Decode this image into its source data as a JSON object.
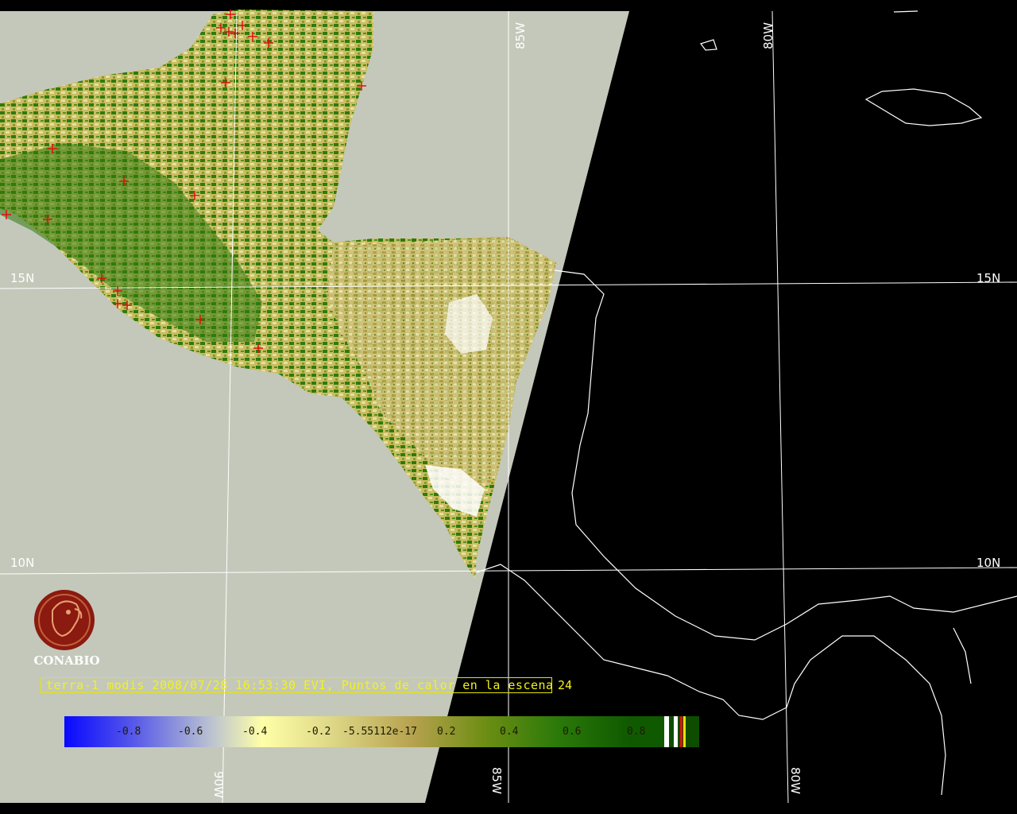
{
  "caption": {
    "text": "terra-1 modis 2008/07/28 16:53:30 EVI, Puntos de calor en la escena",
    "count": "24"
  },
  "logo": {
    "text": "CONABIO",
    "icon": "conabio-macaw-icon",
    "color": "#8b1a10"
  },
  "grid": {
    "lat_labels": [
      "15N",
      "15N",
      "10N",
      "10N"
    ],
    "lon_labels_top": [
      "85W",
      "80W"
    ],
    "lon_labels_bottom": [
      "90W",
      "85W",
      "80W"
    ]
  },
  "colorbar": {
    "ticks": [
      "-0.8",
      "-0.6",
      "-0.4",
      "-0.2",
      "-5.55112e-17",
      "0.2",
      "0.4",
      "0.6",
      "0.8"
    ],
    "colors": [
      "#0a0aff",
      "#7f80d9",
      "#c9d3c0",
      "#ffffa0",
      "#dedc8a",
      "#c7b25c",
      "#9c9a1c",
      "#3f8f0f",
      "#1a6a00",
      "#0e4d00"
    ]
  },
  "colors": {
    "swath": "#c4c8ba",
    "vegetation_green": "#2e7a0c",
    "vegetation_yellow": "#d8cf7a",
    "hotspot": "#e01010",
    "coast": "#ffffff"
  }
}
